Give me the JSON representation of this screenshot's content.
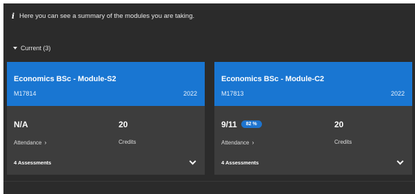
{
  "info": {
    "text": "Here you can see a summary of the modules you are taking."
  },
  "section": {
    "label": "Current (3)"
  },
  "modules": [
    {
      "title": "Economics BSc - Module-S2",
      "code": "M17814",
      "year": "2022",
      "attendance_value": "N/A",
      "attendance_percent": "",
      "credits_value": "20",
      "attendance_label": "Attendance",
      "credits_label": "Credits",
      "assessments_label": "4 Assessments"
    },
    {
      "title": "Economics BSc - Module-C2",
      "code": "M17813",
      "year": "2022",
      "attendance_value": "9/11",
      "attendance_percent": "82 %",
      "credits_value": "20",
      "attendance_label": "Attendance",
      "credits_label": "Credits",
      "assessments_label": "4 Assessments"
    }
  ],
  "colors": {
    "header_blue": "#1976d2",
    "background_dark": "#2b2b2b",
    "card_body": "#3d3d3d"
  }
}
